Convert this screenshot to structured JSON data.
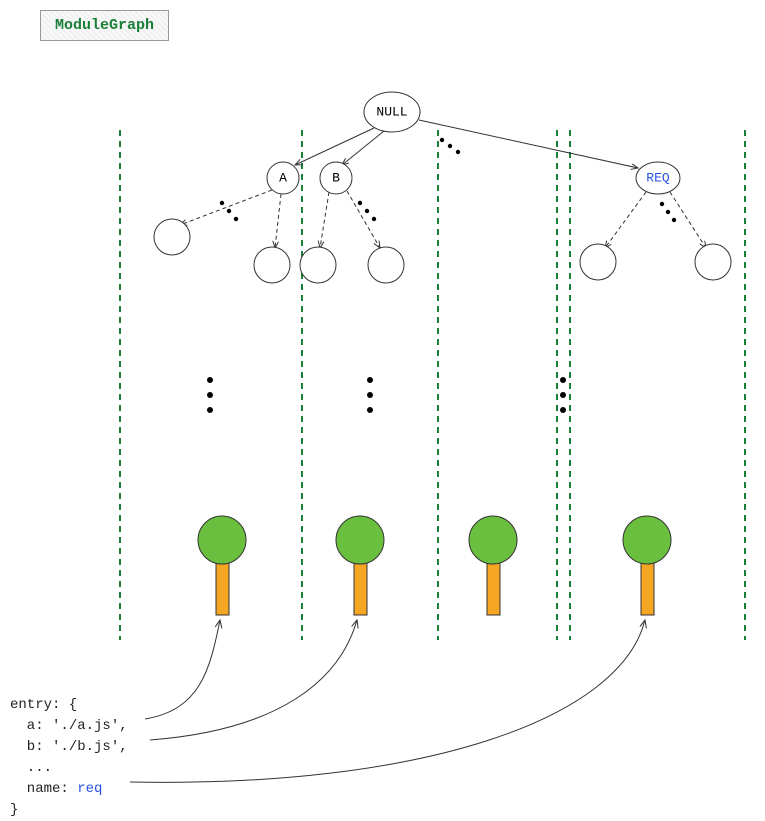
{
  "title": "ModuleGraph",
  "root": {
    "label": "NULL"
  },
  "children": {
    "a": "A",
    "b": "B",
    "req": "REQ"
  },
  "code": {
    "entry_label": "entry: {",
    "line_a_key": "  a:",
    "line_a_val": " './a.js',",
    "line_b_key": "  b:",
    "line_b_val": " './b.js',",
    "ellipsis": "  ...",
    "line_name_key": "  name:",
    "line_name_val": " req",
    "close": "}"
  },
  "colors": {
    "title": "#1a7f37",
    "req": "#2952e3",
    "leaf": "#6bbf3e",
    "trunk": "#f5a623"
  }
}
